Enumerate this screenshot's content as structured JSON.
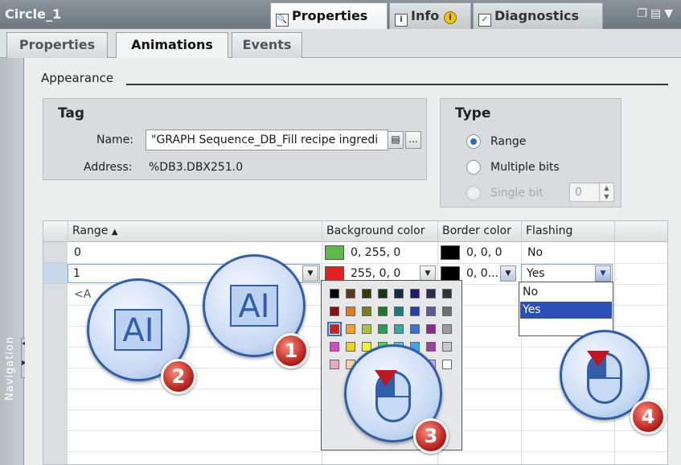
{
  "window": {
    "title": "Circle_1"
  },
  "top_tabs": [
    {
      "label": "Properties"
    },
    {
      "label": "Info"
    },
    {
      "label": "Diagnostics"
    }
  ],
  "sub_tabs": [
    {
      "label": "Properties"
    },
    {
      "label": "Animations"
    },
    {
      "label": "Events"
    }
  ],
  "navigation": {
    "label": "Navigation"
  },
  "appearance": {
    "title": "Appearance"
  },
  "tag": {
    "title": "Tag",
    "name_label": "Name:",
    "name_value": "\"GRAPH Sequence_DB_Fill recipe ingredi",
    "address_label": "Address:",
    "address_value": "%DB3.DBX251.0",
    "browse_label": "..."
  },
  "type": {
    "title": "Type",
    "options": [
      {
        "label": "Range",
        "selected": true
      },
      {
        "label": "Multiple bits",
        "selected": false
      },
      {
        "label": "Single bit",
        "selected": false,
        "disabled": true
      }
    ],
    "bit_value": "0"
  },
  "table": {
    "headers": [
      "Range",
      "Background color",
      "Border color",
      "Flashing"
    ],
    "rows": [
      {
        "range": "0",
        "bg_color": "0, 255, 0",
        "bg_hex": "#5fb84a",
        "border_color": "0, 0, 0",
        "border_hex": "#000000",
        "flashing": "No"
      },
      {
        "range": "1",
        "bg_color": "255, 0, 0",
        "bg_hex": "#e52222",
        "border_color": "0, 0...",
        "border_hex": "#000000",
        "flashing": "Yes"
      }
    ],
    "add_row": "<A"
  },
  "flashing_options": [
    "No",
    "Yes"
  ],
  "palette_colors": [
    "#000000",
    "#5a3a1a",
    "#3a3a0a",
    "#123a14",
    "#10304a",
    "#1d1d6e",
    "#2b2b55",
    "#333333",
    "#8b1010",
    "#e07b1c",
    "#7d7d1e",
    "#1d7a2a",
    "#1f7b7b",
    "#1f3fb0",
    "#5b5b9b",
    "#707070",
    "#c8201c",
    "#f5a020",
    "#a8c23c",
    "#27a04c",
    "#35a7a7",
    "#3a72d6",
    "#8a2a8a",
    "#9a9a9a",
    "#d848c8",
    "#f0d020",
    "#f5f030",
    "#40e040",
    "#40d0e8",
    "#40a8f0",
    "#a040a0",
    "#c8c8c8",
    "#f0a8c8",
    "#f8d0a0",
    "#f8f8a8",
    "#c8f0c8",
    "#c8f0f0",
    "#a8c8f0",
    "#c8a8e8",
    "#ffffff"
  ],
  "callouts": [
    "1",
    "2",
    "3",
    "4"
  ],
  "colors": {
    "accent": "#2f5fa8",
    "highlight": "#2d4fb8",
    "badge": "#c0161f"
  }
}
